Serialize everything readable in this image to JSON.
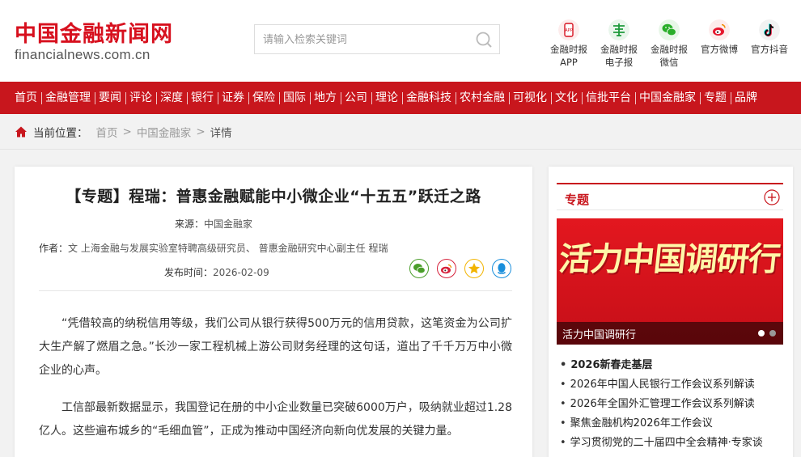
{
  "header": {
    "logo_cn": "中国金融新闻网",
    "logo_en": "financialnews.com.cn",
    "search_placeholder": "请输入检索关键词",
    "apps": [
      {
        "line1": "金融时报",
        "line2": "APP",
        "icon": "app-icon"
      },
      {
        "line1": "金融时报",
        "line2": "电子报",
        "icon": "epaper-icon"
      },
      {
        "line1": "金融时报",
        "line2": "微信",
        "icon": "wechat-icon"
      },
      {
        "line1": "官方微博",
        "line2": "",
        "icon": "weibo-icon"
      },
      {
        "line1": "官方抖音",
        "line2": "",
        "icon": "douyin-icon"
      }
    ]
  },
  "nav": [
    "首页",
    "金融管理",
    "要闻",
    "评论",
    "深度",
    "银行",
    "证券",
    "保险",
    "国际",
    "地方",
    "公司",
    "理论",
    "金融科技",
    "农村金融",
    "可视化",
    "文化",
    "信批平台",
    "中国金融家",
    "专题",
    "品牌"
  ],
  "breadcrumb": {
    "label": "当前位置：",
    "items": [
      "首页",
      "中国金融家"
    ],
    "current": "详情"
  },
  "article": {
    "title": "【专题】程瑞：普惠金融赋能中小微企业“十五五”跃迁之路",
    "source_label": "来源：",
    "source": "中国金融家",
    "author_label": "作者：",
    "author": "文 上海金融与发展实验室特聘高级研究员、 普惠金融研究中心副主任 程瑞",
    "date_label": "发布时间：",
    "date": "2026-02-09",
    "paragraphs": [
      "“凭借较高的纳税信用等级，我们公司从银行获得500万元的信用贷款，这笔资金为公司扩大生产解了燃眉之急。”长沙一家工程机械上游公司财务经理的这句话，道出了千千万万中小微企业的心声。",
      "工信部最新数据显示，我国登记在册的中小企业数量已突破6000万户，吸纳就业超过1.28亿人。这些遍布城乡的“毛细血管”，正成为推动中国经济向新向优发展的关键力量。"
    ]
  },
  "sidebar": {
    "title": "专题",
    "banner_text": "活力中国调研行",
    "banner_caption": "活力中国调研行",
    "items": [
      {
        "text": "2026新春走基层",
        "bold": true
      },
      {
        "text": "2026年中国人民银行工作会议系列解读",
        "bold": false
      },
      {
        "text": "2026年全国外汇管理工作会议系列解读",
        "bold": false
      },
      {
        "text": "聚焦金融机构2026年工作会议",
        "bold": false
      },
      {
        "text": "学习贯彻党的二十届四中全会精神·专家谈",
        "bold": false
      }
    ]
  },
  "colors": {
    "brand_red": "#c8161d",
    "wechat_green": "#4a9e2a",
    "weibo_red": "#d6203a",
    "qzone_yellow": "#f2b400",
    "qq_blue": "#1a8fdc"
  }
}
